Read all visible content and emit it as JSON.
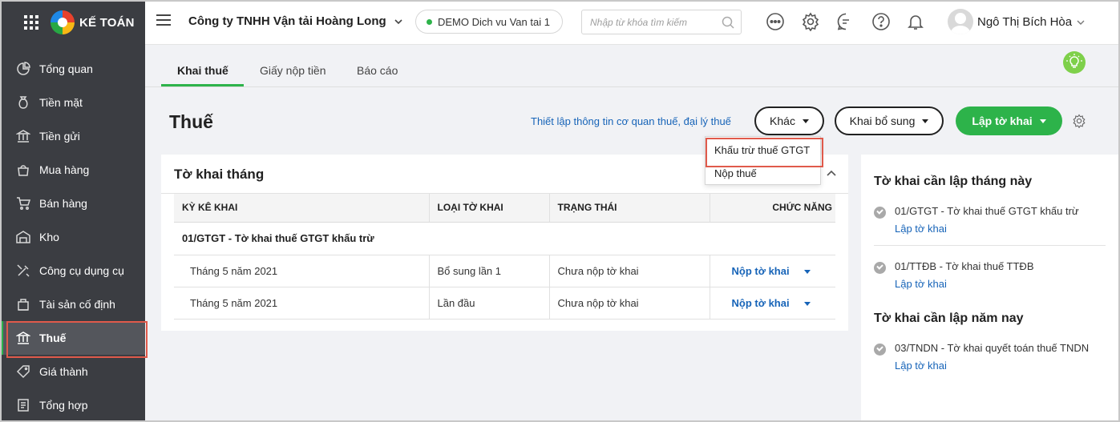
{
  "app": {
    "logo_text": "KẾ TOÁN"
  },
  "sidebar": {
    "items": [
      {
        "label": "Tổng quan",
        "icon": "dashboard-icon"
      },
      {
        "label": "Tiền mặt",
        "icon": "money-bag-icon"
      },
      {
        "label": "Tiền gửi",
        "icon": "bank-icon"
      },
      {
        "label": "Mua hàng",
        "icon": "shopping-bag-icon"
      },
      {
        "label": "Bán hàng",
        "icon": "cart-icon"
      },
      {
        "label": "Kho",
        "icon": "warehouse-icon"
      },
      {
        "label": "Công cụ dụng cụ",
        "icon": "tools-icon"
      },
      {
        "label": "Tài sản cố định",
        "icon": "asset-icon"
      },
      {
        "label": "Thuế",
        "icon": "tax-icon",
        "active": true
      },
      {
        "label": "Giá thành",
        "icon": "price-tag-icon"
      },
      {
        "label": "Tổng hợp",
        "icon": "report-icon"
      }
    ]
  },
  "header": {
    "company": "Công ty TNHH Vận tải Hoàng Long",
    "demo_label": "DEMO Dich vu Van tai 1",
    "search_placeholder": "Nhập từ khóa tìm kiếm",
    "user_name": "Ngô Thị Bích Hòa",
    "icons": [
      "more-icon",
      "gear-icon",
      "chat-icon",
      "help-icon",
      "bell-icon"
    ]
  },
  "tabs": [
    {
      "label": "Khai thuế",
      "active": true
    },
    {
      "label": "Giấy nộp tiền"
    },
    {
      "label": "Báo cáo"
    }
  ],
  "page": {
    "title": "Thuế",
    "setup_link": "Thiết lập thông tin cơ quan thuế, đại lý thuế",
    "btn_other": "Khác",
    "btn_supplement": "Khai bổ sung",
    "btn_create": "Lập tờ khai"
  },
  "dropdown": {
    "items": [
      "Khấu trừ thuế GTGT",
      "Nộp thuế"
    ]
  },
  "card": {
    "title": "Tờ khai tháng",
    "columns": [
      "KỲ KÊ KHAI",
      "LOẠI TỜ KHAI",
      "TRẠNG THÁI",
      "CHỨC NĂNG"
    ],
    "group": "01/GTGT - Tờ khai thuế GTGT khấu trừ",
    "rows": [
      {
        "period": "Tháng 5 năm 2021",
        "type": "Bổ sung lần 1",
        "status": "Chưa nộp tờ khai",
        "action": "Nộp tờ khai"
      },
      {
        "period": "Tháng 5 năm 2021",
        "type": "Lần đầu",
        "status": "Chưa nộp tờ khai",
        "action": "Nộp tờ khai"
      }
    ]
  },
  "right_panel": {
    "monthly_title": "Tờ khai cần lập tháng này",
    "monthly": [
      {
        "name": "01/GTGT - Tờ khai thuế GTGT khấu trừ",
        "link": "Lập tờ khai"
      },
      {
        "name": "01/TTĐB - Tờ khai thuế TTĐB",
        "link": "Lập tờ khai"
      }
    ],
    "yearly_title": "Tờ khai cần lập năm nay",
    "yearly": [
      {
        "name": "03/TNDN - Tờ khai quyết toán thuế TNDN",
        "link": "Lập tờ khai"
      }
    ]
  },
  "colors": {
    "accent": "#2db34a",
    "link": "#1764b8",
    "sidebar": "#3b3d42",
    "highlight": "#e05a4b"
  }
}
